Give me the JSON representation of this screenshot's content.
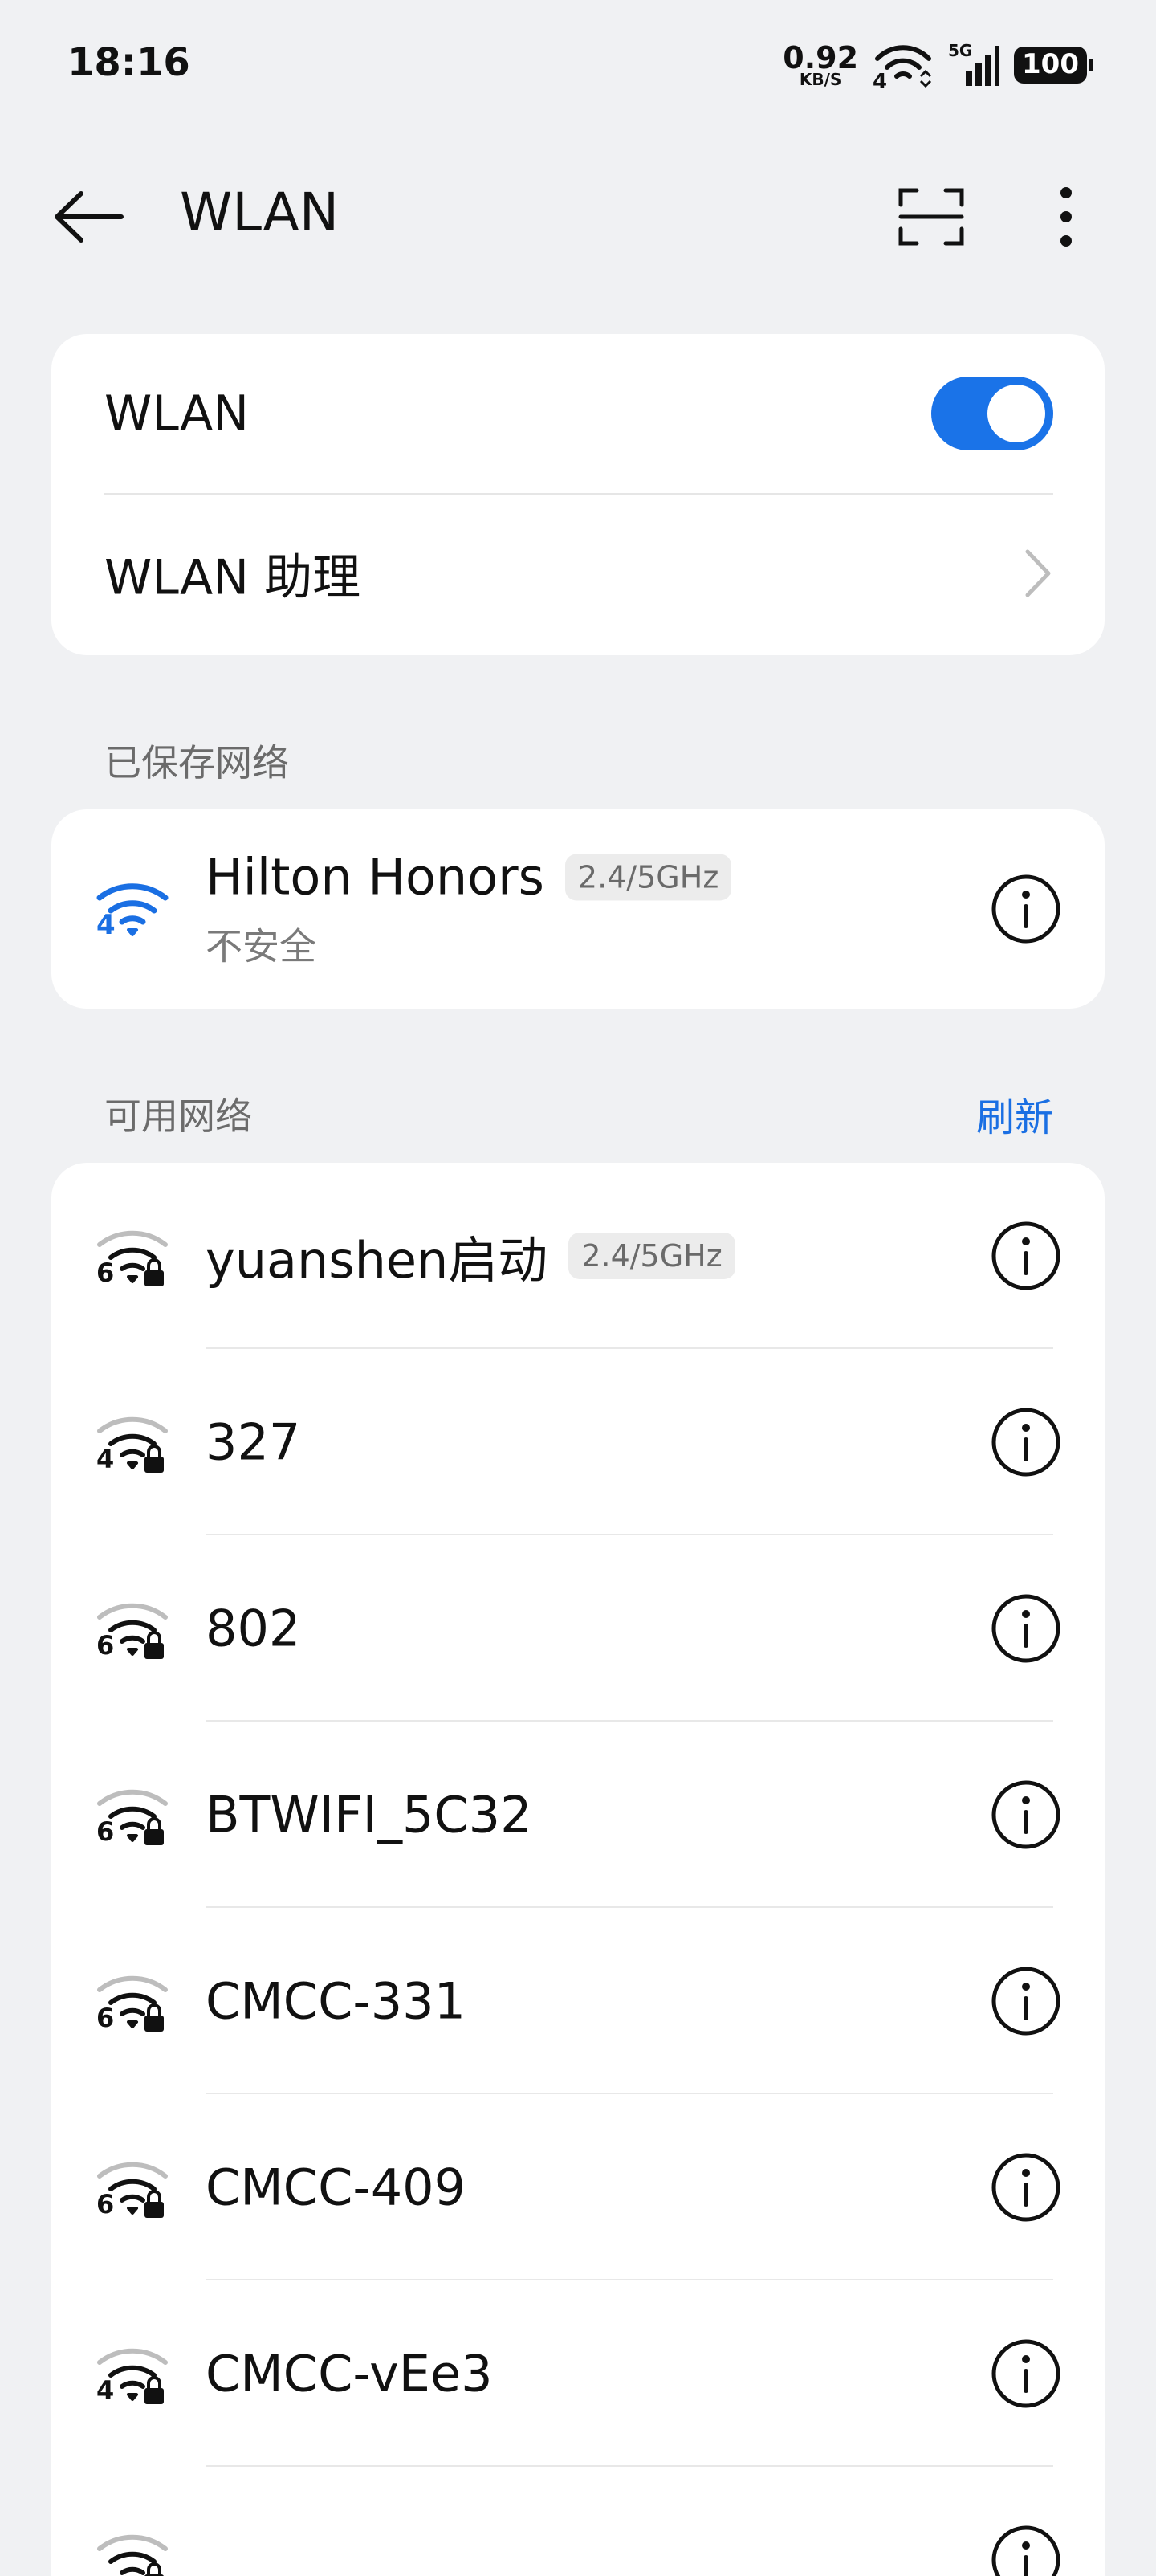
{
  "status_bar": {
    "time": "18:16",
    "speed_value": "0.92",
    "speed_unit": "KB/S",
    "wifi_gen": "4",
    "network_type": "5G",
    "battery": "100"
  },
  "app_bar": {
    "title": "WLAN",
    "back_icon": "back-arrow-icon",
    "scan_icon": "scan-icon",
    "more_icon": "more-vertical-icon"
  },
  "settings": {
    "wlan_label": "WLAN",
    "wlan_enabled": true,
    "assistant_label": "WLAN 助理"
  },
  "saved": {
    "section_label": "已保存网络",
    "networks": [
      {
        "name": "Hilton Honors",
        "band": "2.4/5GHz",
        "status": "不安全",
        "gen": "4"
      }
    ]
  },
  "available": {
    "section_label": "可用网络",
    "refresh_label": "刷新",
    "networks": [
      {
        "name": "yuanshen启动",
        "band": "2.4/5GHz",
        "gen": "6"
      },
      {
        "name": "327",
        "gen": "4"
      },
      {
        "name": "802",
        "gen": "6"
      },
      {
        "name": "BTWIFI_5C32",
        "gen": "6"
      },
      {
        "name": "CMCC-331",
        "gen": "6"
      },
      {
        "name": "CMCC-409",
        "gen": "6"
      },
      {
        "name": "CMCC-vEe3",
        "gen": "4"
      }
    ]
  },
  "colors": {
    "accent": "#1a73e8",
    "connected_wifi": "#1a6fe3",
    "background": "#f0f1f3"
  }
}
